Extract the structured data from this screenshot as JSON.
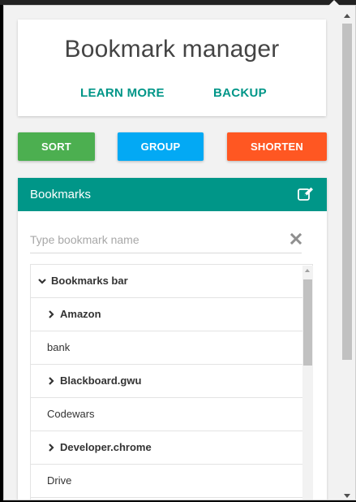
{
  "header": {
    "title": "Bookmark manager",
    "learn_more": "LEARN MORE",
    "backup": "BACKUP"
  },
  "actions": {
    "sort": "SORT",
    "group": "GROUP",
    "shorten": "SHORTEN"
  },
  "colors": {
    "teal": "#009688",
    "sort": "#4caf50",
    "group": "#03a9f4",
    "shorten": "#ff5722"
  },
  "panel": {
    "title": "Bookmarks",
    "edit_icon": "edit-icon",
    "search_placeholder": "Type bookmark name",
    "search_value": "",
    "clear_icon": "close-icon"
  },
  "bookmarks": [
    {
      "label": "Bookmarks bar",
      "type": "folder",
      "expanded": true,
      "depth": 0
    },
    {
      "label": "Amazon",
      "type": "folder",
      "expanded": false,
      "depth": 1
    },
    {
      "label": "bank",
      "type": "link",
      "depth": 1
    },
    {
      "label": "Blackboard.gwu",
      "type": "folder",
      "expanded": false,
      "depth": 1
    },
    {
      "label": "Codewars",
      "type": "link",
      "depth": 1
    },
    {
      "label": "Developer.chrome",
      "type": "folder",
      "expanded": false,
      "depth": 1
    },
    {
      "label": "Drive",
      "type": "link",
      "depth": 1
    }
  ]
}
